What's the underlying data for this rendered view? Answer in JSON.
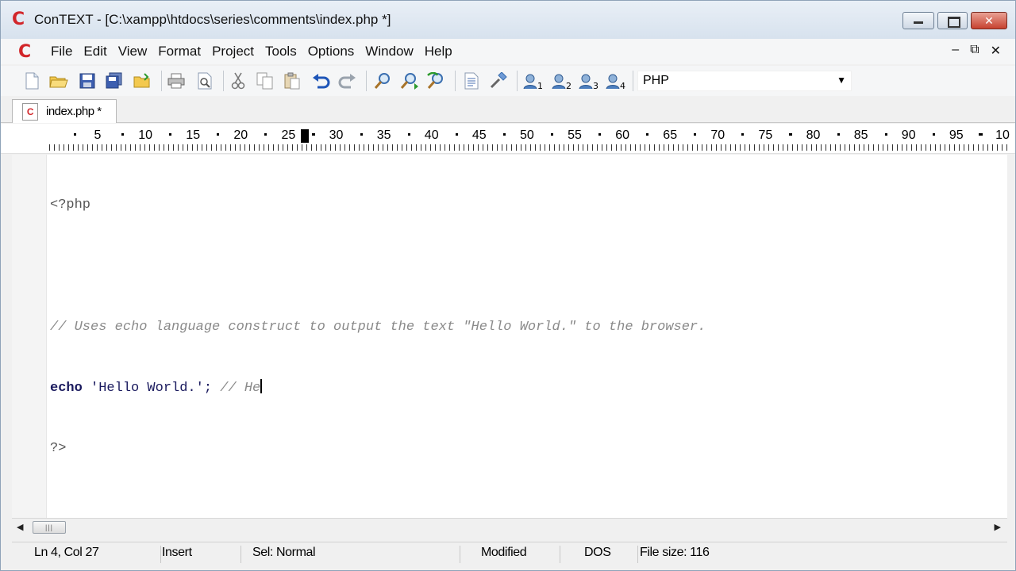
{
  "window": {
    "title": "ConTEXT - [C:\\xampp\\htdocs\\series\\comments\\index.php *]",
    "app_logo": "C"
  },
  "menu": {
    "items": [
      "File",
      "Edit",
      "View",
      "Format",
      "Project",
      "Tools",
      "Options",
      "Window",
      "Help"
    ],
    "mdi_min": "–",
    "mdi_restore": "⧉",
    "mdi_close": "✕"
  },
  "toolbar": {
    "highlighter": "PHP",
    "user_cmd_1": "1",
    "user_cmd_2": "2",
    "user_cmd_3": "3",
    "user_cmd_4": "4",
    "icons": [
      "new-file-icon",
      "open-folder-icon",
      "save-icon",
      "save-all-icon",
      "open-folder-icon-2",
      "print-icon",
      "print-preview-icon",
      "cut-icon",
      "copy-icon",
      "paste-icon",
      "undo-icon",
      "redo-icon",
      "find-icon",
      "find-next-icon",
      "replace-icon",
      "file-list-icon",
      "settings-icon",
      "user-command-icon"
    ]
  },
  "tabs": [
    {
      "label": "index.php *"
    }
  ],
  "ruler": {
    "numbers": [
      "5",
      "10",
      "15",
      "20",
      "25",
      "30",
      "35",
      "40",
      "45",
      "50",
      "55",
      "60",
      "65",
      "70",
      "75",
      "80",
      "85",
      "90",
      "95",
      "10"
    ]
  },
  "editor": {
    "line1": "<?php",
    "line3": "// Uses echo language construct to output the text \"Hello World.\" to the browser.",
    "line4_kw": "echo",
    "line4_str": " 'Hello World.';",
    "line4_cmt": " // He",
    "line5": "?>"
  },
  "status": {
    "position": "Ln 4, Col 27",
    "mode": "Insert",
    "selection": "Sel: Normal",
    "modified": "Modified",
    "line_endings": "DOS",
    "file_size": "File size: 116"
  }
}
